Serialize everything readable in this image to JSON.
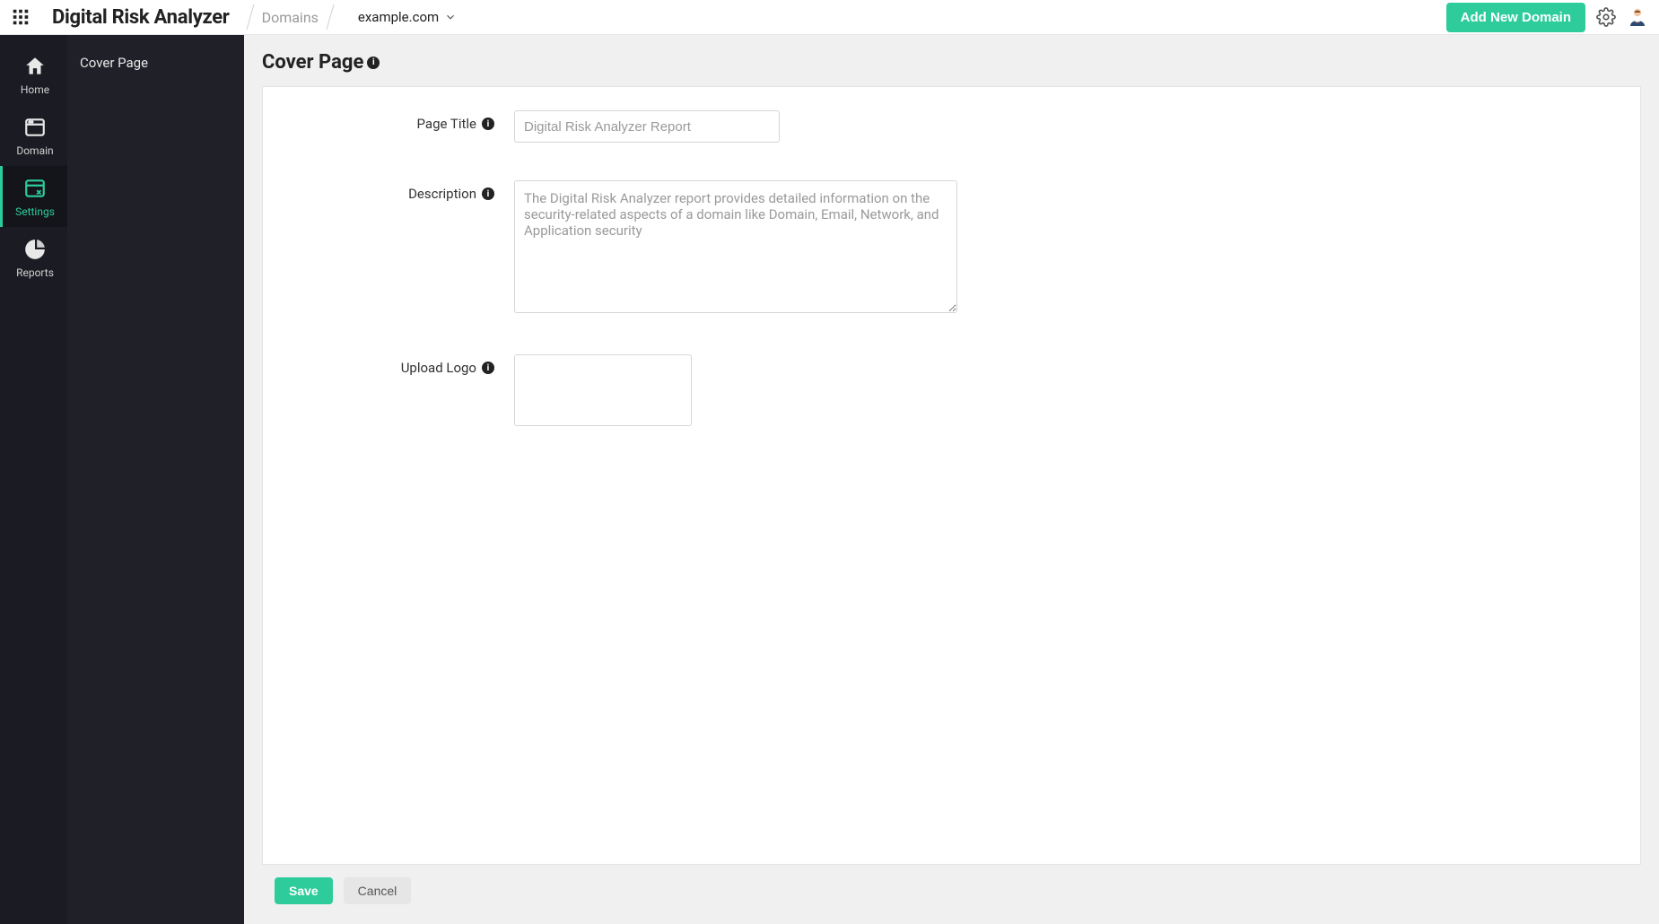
{
  "topbar": {
    "brand": "Digital Risk Analyzer",
    "breadcrumb_domains": "Domains",
    "current_domain": "example.com",
    "add_domain_label": "Add New Domain"
  },
  "nav": {
    "items": [
      {
        "label": "Home"
      },
      {
        "label": "Domain"
      },
      {
        "label": "Settings"
      },
      {
        "label": "Reports"
      }
    ]
  },
  "subnav": {
    "items": [
      {
        "label": "Cover Page"
      }
    ]
  },
  "page": {
    "title": "Cover Page"
  },
  "form": {
    "page_title": {
      "label": "Page Title",
      "placeholder": "Digital Risk Analyzer Report",
      "value": ""
    },
    "description": {
      "label": "Description",
      "placeholder": "The Digital Risk Analyzer report provides detailed information on the security-related aspects of a domain like Domain, Email, Network, and Application security",
      "value": ""
    },
    "upload_logo": {
      "label": "Upload Logo"
    }
  },
  "actions": {
    "save": "Save",
    "cancel": "Cancel"
  }
}
